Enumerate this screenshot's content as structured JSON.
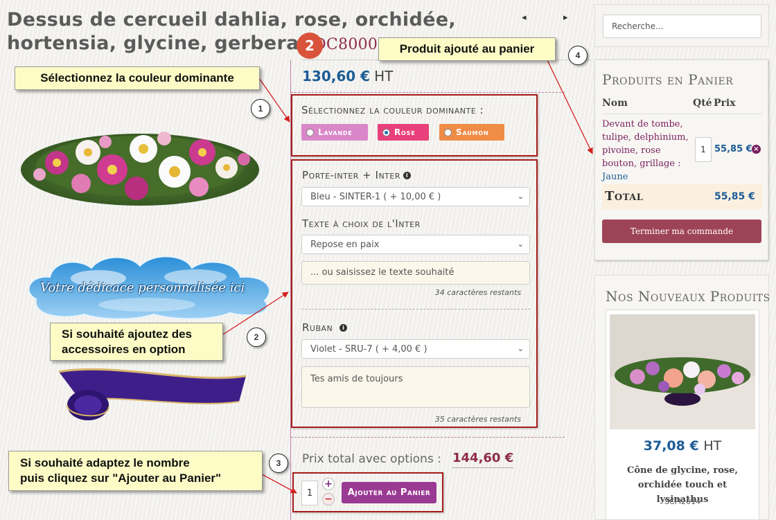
{
  "product": {
    "title": "Dessus de cercueil dahlia, rose, orchidée, hortensia, glycine, gerbera",
    "sku": "SDC80007-1",
    "step_badge": "2",
    "prev_arrow": "◂",
    "next_arrow": "▸",
    "price": "130,60 €",
    "price_unit": "HT"
  },
  "color_select": {
    "label": "Sélectionnez la couleur dominante :",
    "options": [
      {
        "label": "Lavande",
        "selected": false,
        "color": "#d987c9"
      },
      {
        "label": "Rose",
        "selected": true,
        "color": "#e8407a"
      },
      {
        "label": "Saumon",
        "selected": false,
        "color": "#ef8c46"
      }
    ]
  },
  "accessories": {
    "porte_inter_label": "Porte-inter + Inter",
    "porte_inter_value": "Bleu - SINTER-1 ( + 10,00 € )",
    "texte_label": "Texte à choix de l'Inter",
    "texte_value": "Repose en paix",
    "texte_placeholder": "... ou saisissez le texte souhaité",
    "texte_counter": "34 caractères restants",
    "ruban_label": "Ruban",
    "ruban_value": "Violet - SRU-7 ( + 4,00 € )",
    "ruban_text": "Tes amis de toujours",
    "ruban_counter": "35 caractères restants"
  },
  "total_options": {
    "label": "Prix total avec options :",
    "value": "144,60 €"
  },
  "add_to_cart": {
    "quantity": "1",
    "plus": "+",
    "minus": "−",
    "button": "Ajouter au Panier"
  },
  "dedicace_text": "Votre dédicace personnalisée ici",
  "callouts": {
    "c1": "Sélectionnez la couleur dominante",
    "c2_line1": "Si souhaité ajoutez des",
    "c2_line2": "accessoires en option",
    "c3_line1": "Si souhaité adaptez le nombre",
    "c3_line2": "puis cliquez sur \"Ajouter au Panier\"",
    "c4": "Produit ajouté au panier",
    "n1": "1",
    "n2": "2",
    "n3": "3",
    "n4": "4"
  },
  "sidebar": {
    "search_placeholder": "Recherche...",
    "cart": {
      "title": "Produits en Panier",
      "col_name": "Nom",
      "col_qty": "Qté",
      "col_price": "Prix",
      "item_name": "Devant de tombe, tulipe, delphinium, pivoine, rose bouton, grillage :",
      "item_variant": "Jaune",
      "item_qty": "1",
      "item_price": "55,85 €",
      "total_label": "Total",
      "total_value": "55,85 €",
      "checkout": "Terminer ma commande"
    },
    "new_products": {
      "title": "Nos Nouveaux Produits",
      "price": "37,08 €",
      "price_unit": "HT",
      "name": "Cône de glycine, rose, orchidée touch et lysinathus",
      "sku": "SCFI2014"
    }
  },
  "colors": {
    "accent": "#9e4459",
    "price_blue": "#1c5c96",
    "sku_red": "#8e2c4a",
    "callout_bg": "#fdfcc6",
    "box_red": "#a61c1c"
  }
}
